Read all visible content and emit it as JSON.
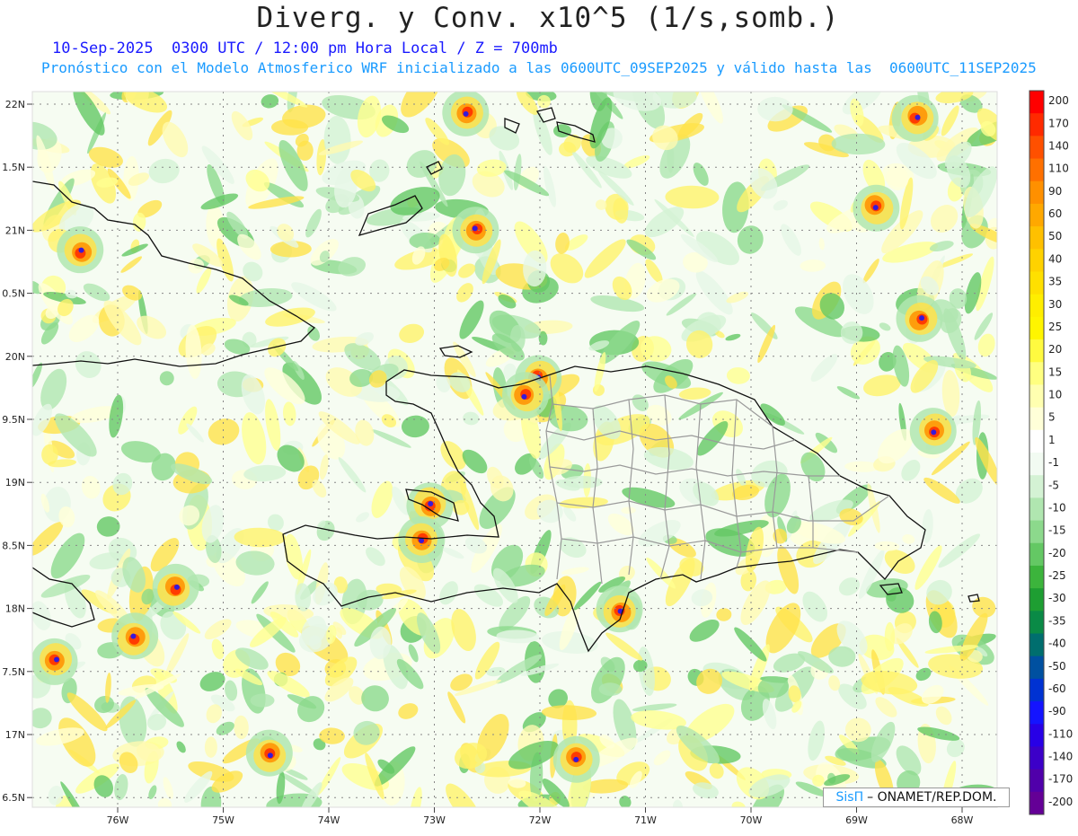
{
  "title": "Diverg. y Conv. x10^5 (1/s,somb.)",
  "subtitle": "10-Sep-2025  0300 UTC / 12:00 pm Hora Local / Z = 700mb",
  "subtitle2": "Pronóstico con el Modelo Atmosferico WRF inicializado a las 0600UTC_09SEP2025 y válido hasta las  0600UTC_11SEP2025",
  "lat_labels": [
    "22N",
    "1.5N",
    "21N",
    "0.5N",
    "20N",
    "9.5N",
    "19N",
    "8.5N",
    "18N",
    "7.5N",
    "17N",
    "6.5N"
  ],
  "lon_labels": [
    "76W",
    "75W",
    "74W",
    "73W",
    "72W",
    "71W",
    "70W",
    "69W",
    "68W"
  ],
  "colorbar": {
    "labels": [
      "200",
      "170",
      "140",
      "110",
      "90",
      "60",
      "50",
      "40",
      "35",
      "30",
      "25",
      "20",
      "15",
      "10",
      "5",
      "1",
      "-1",
      "-5",
      "-10",
      "-15",
      "-20",
      "-25",
      "-30",
      "-35",
      "-40",
      "-50",
      "-60",
      "-90",
      "-110",
      "-140",
      "-170",
      "-200"
    ],
    "colors": [
      "#ff0000",
      "#ff2a00",
      "#ff5000",
      "#ff7000",
      "#ff9000",
      "#ffa800",
      "#ffc000",
      "#ffd200",
      "#ffe000",
      "#ffee00",
      "#fff500",
      "#fffa40",
      "#ffff80",
      "#ffffb0",
      "#ffffd8",
      "#ffffff",
      "#f2fbf2",
      "#d4f2d4",
      "#b0e6b0",
      "#8cd98c",
      "#64c864",
      "#3cb43c",
      "#1e9e32",
      "#0a8a46",
      "#006e6e",
      "#0050a0",
      "#0032d2",
      "#1414ff",
      "#2800e6",
      "#3c00c8",
      "#5000aa",
      "#640096"
    ]
  },
  "credit": {
    "brand": "SisΠ",
    "text": "– ONAMET/REP.DOM."
  }
}
